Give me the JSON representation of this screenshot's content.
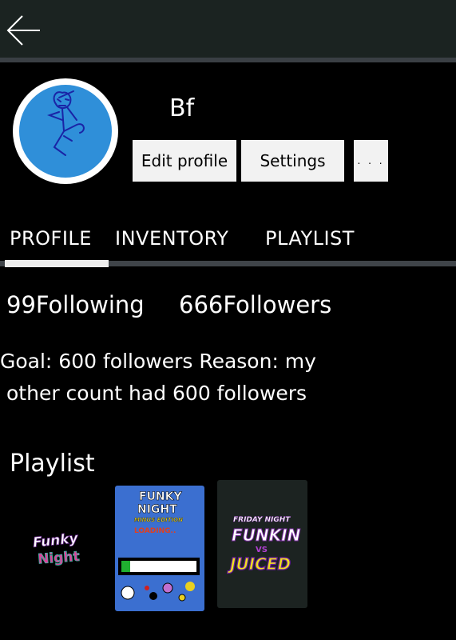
{
  "header": {
    "back_icon": "arrow-left-icon"
  },
  "profile": {
    "username": "Bf",
    "avatar_icon": "stick-figure-avatar",
    "buttons": {
      "edit": "Edit profile",
      "settings": "Settings",
      "more": ". . ."
    }
  },
  "tabs": [
    {
      "label": "PROFILE",
      "active": true
    },
    {
      "label": "INVENTORY",
      "active": false
    },
    {
      "label": "PLAYLIST",
      "active": false
    }
  ],
  "stats": {
    "following": "99Following",
    "followers": "666Followers"
  },
  "bio": {
    "line1": "Goal: 600 followers Reason: my",
    "line2": "other count had 600 followers"
  },
  "playlist": {
    "title": "Playlist",
    "items": [
      {
        "title": "Funky Night",
        "cover_lines": [
          "Funky",
          "Night"
        ]
      },
      {
        "title": "FUNKY NIGHT",
        "cover_lines": [
          "FUNKY",
          "NIGHT",
          "MINUS EDITION",
          "LOADING.."
        ],
        "progress": 0.12
      },
      {
        "title": "Friday Night Funkin vs Juiced",
        "cover_lines": [
          "FRIDAY NIGHT",
          "FUNKIN",
          "VS",
          "JUICED"
        ]
      }
    ]
  },
  "colors": {
    "background": "#000000",
    "topbar": "#1b2321",
    "avatar_fill": "#2f8fd9",
    "button_bg": "#f2f2f2",
    "tab_indicator": "#eeeeee",
    "cover_blue": "#3b6fd0"
  }
}
